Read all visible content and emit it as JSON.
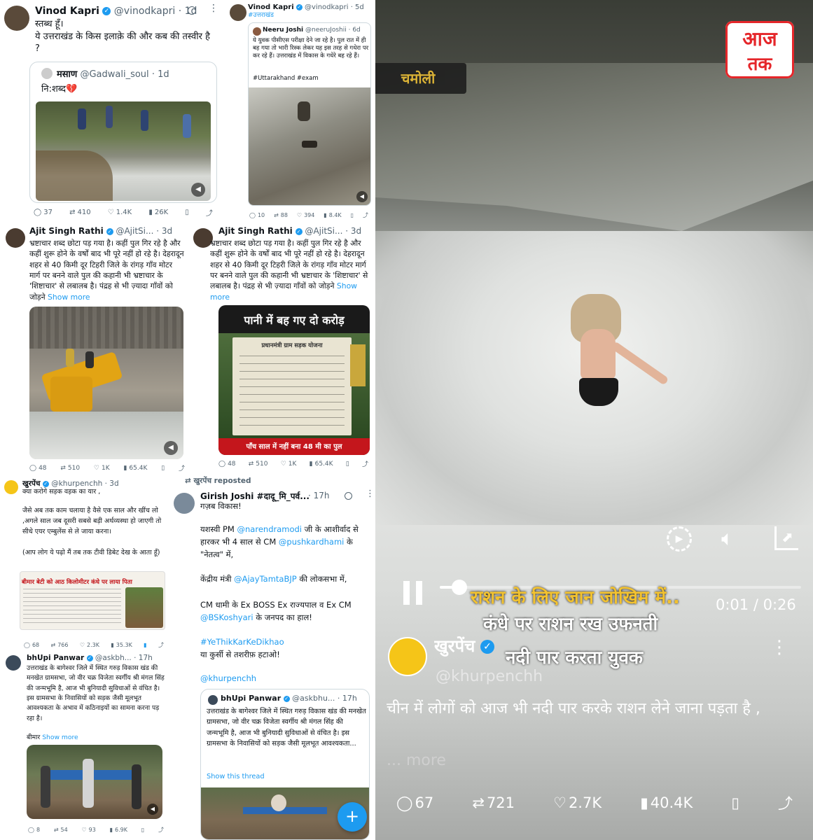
{
  "colors": {
    "accent": "#1d9bf0",
    "aajtak_red": "#e5262a",
    "caption_yellow": "#f2c230"
  },
  "t1": {
    "name": "Vinod Kapri",
    "handle": "@vinodkapri",
    "time": "· 1d",
    "text1": "स्तब्ध हूँ।",
    "text2": "ये उत्तराखंड के किस इलाक़े की और कब की तस्वीर है ?",
    "quote_name": "मसाण",
    "quote_handle": "@Gadwali_soul",
    "quote_time": "· 1d",
    "quote_text": "नि:शब्द💔",
    "replies": "37",
    "reposts": "410",
    "likes": "1.4K",
    "views": "26K"
  },
  "t2": {
    "name": "Vinod Kapri",
    "handle": "@vinodkapri",
    "time": "· 5d",
    "hashtag": "#उत्तराखंड",
    "quote_name": "Neeru Joshi",
    "quote_handle": "@neeruJoshii",
    "quote_time": "· 6d",
    "quote_text": "ये युवक पीसीएस परीक्षा देने जा रहे है। पुल रात में ही बह गया तो भारी रिस्क लेकर यह इस तरह से गधेरा पर कर रहे हैं। उत्तराखंड में विकास के गधेरे बह रहे हैं।",
    "quote_tags": "#Uttarakhand #exam",
    "replies": "10",
    "reposts": "88",
    "likes": "394",
    "views": "8.4K"
  },
  "t3": {
    "name": "Ajit Singh Rathi",
    "handle": "@AjitSi...",
    "time": "· 3d",
    "text": "भ्रष्टाचार शब्द छोटा पड़ गया है। कहीं पुल गिर रहे है और कहीं शुरू होने के वर्षों बाद भी पूरे नहीं हो रहे है। देहरादून शहर से 40 किमी दूर टिहरी जिले के रांगड़ गाँव मोटर मार्ग पर बनने वाले पुल की कहानी भी भ्रष्टाचार के 'शिष्टाचार' से लबालब है। पंद्रह से भी ज़्यादा गाँवों को जोड़ने",
    "more": "Show more",
    "replies": "48",
    "reposts": "510",
    "likes": "1K",
    "views": "65.4K"
  },
  "t4": {
    "name": "Ajit Singh Rathi",
    "handle": "@AjitSi...",
    "time": "· 3d",
    "text": "भ्रष्टाचार शब्द छोटा पड़ गया है। कहीं पुल गिर रहे है और कहीं शुरू होने के वर्षों बाद भी पूरे नहीं हो रहे है। देहरादून शहर से 40 किमी दूर टिहरी जिले के रांगड़ गाँव मोटर मार्ग पर बनने वाले पुल की कहानी भी भ्रष्टाचार के 'शिष्टाचार' से लबालब है। पंद्रह से भी ज़्यादा गाँवों को जोड़ने",
    "more": "Show more",
    "img_top": "पानी में बह गए दो करोड़",
    "img_board": "प्रधानमंत्री ग्राम सड़क योजना",
    "img_bottom": "पाँच साल में नहीं बना 48 मी का पुल",
    "replies": "48",
    "reposts": "510",
    "likes": "1K",
    "views": "65.4K"
  },
  "t5": {
    "name": "खुरपेंच",
    "handle": "@khurpenchh",
    "time": "· 3d",
    "text1": "क्या करोगे सड़क वड़क का यार ,",
    "text2": "जैसे अब तक काम चलाया है वैसे एक साल और खींच लो ,अगले साल जब दूसरी सबसे बड़ी अर्थव्यस्था हो जाएगी तो सीधे एयर एम्बुलेंस से ले जाया करना।",
    "text3": "(आप लोग ये पढ़ो मैं तब तक टीवी डिबेट देख के आता हूँ)",
    "news_head": "बीमार बेटी को आठ किलोमीटर कंधे पर लाया पिता",
    "replies": "68",
    "reposts": "766",
    "likes": "2.3K",
    "views": "35.3K"
  },
  "t6": {
    "name": "bhUpi Panwar",
    "handle": "@askbh...",
    "time": "· 17h",
    "text": "उत्तराखंड के बागेश्वर जिले में स्थित गरुड़ विकास खंड की मनखेत ग्रामसभा, जो वीर चक्र विजेता स्वर्गीय श्री मंगल सिंह की जन्मभूमि है, आज भी बुनियादी सुविधाओं से वंचित है। इस ग्रामसभा के निवासियों को सड़क जैसी मूलभूत आवश्यकता के अभाव में कठिनाइयों का सामना करना पड़ रहा है।",
    "text2": "बीमार",
    "more": "Show more",
    "replies": "8",
    "reposts": "54",
    "likes": "93",
    "views": "6.9K"
  },
  "t7": {
    "reposted": "खुरपेंच reposted",
    "name": "Girish Joshi #दादू_मि_पर्व...",
    "time": "· 17h",
    "l1": "गज़ब विकास!",
    "l2a": "यशस्वी PM ",
    "l2m": "@narendramodi",
    "l2b": " जी के आशीर्वाद से हारकर भी 4 साल से CM ",
    "l2m2": "@pushkardhami",
    "l2c": " के \"नेतत्व\" में,",
    "l3a": "केंद्रीय मंत्री ",
    "l3m": "@AjayTamtaBJP",
    "l3b": " की लोकसभा में,",
    "l4a": "CM धामी के Ex BOSS Ex राज्यपाल व Ex CM ",
    "l4m": "@BSKoshyari",
    "l4b": " के जनपद का हाल!",
    "l5": "#YeThikKarKeDikhao",
    "l6": "या कुर्सी से तशरीफ़ हटाओ!",
    "l7": "@khurpenchh",
    "quote_name": "bhUpi Panwar",
    "quote_handle": "@askbhu...",
    "quote_time": "· 17h",
    "quote_text": "उत्तराखंड के बागेश्वर जिले में स्थित गरुड़ विकास खंड की मनखेत ग्रामसभा, जो वीर चक्र विजेता स्वर्गीय श्री मंगल सिंह की जन्मभूमि है, आज भी बुनियादी सुविधाओं से वंचित है। इस ग्रामसभा के निवासियों को सड़क जैसी मूलभूत आवश्यकता...",
    "thread": "Show this thread",
    "fab": "+"
  },
  "video": {
    "logo_top": "आज",
    "logo_bottom": "तक",
    "location": "चमोली",
    "cap1": "राशन के लिए जान जोखिम में..",
    "cap2": "कंधे पर राशन रख उफनती",
    "cap3": "नदी पार करता युवक",
    "time": "0:01 / 0:26",
    "progress": 0.04,
    "name": "खुरपेंच",
    "handle": "@khurpenchh",
    "text": "चीन में लोगों को आज भी नदी पार करके राशन लेने जाना पड़ता है ,",
    "more": "... more",
    "replies": "67",
    "reposts": "721",
    "likes": "2.7K",
    "views": "40.4K"
  }
}
